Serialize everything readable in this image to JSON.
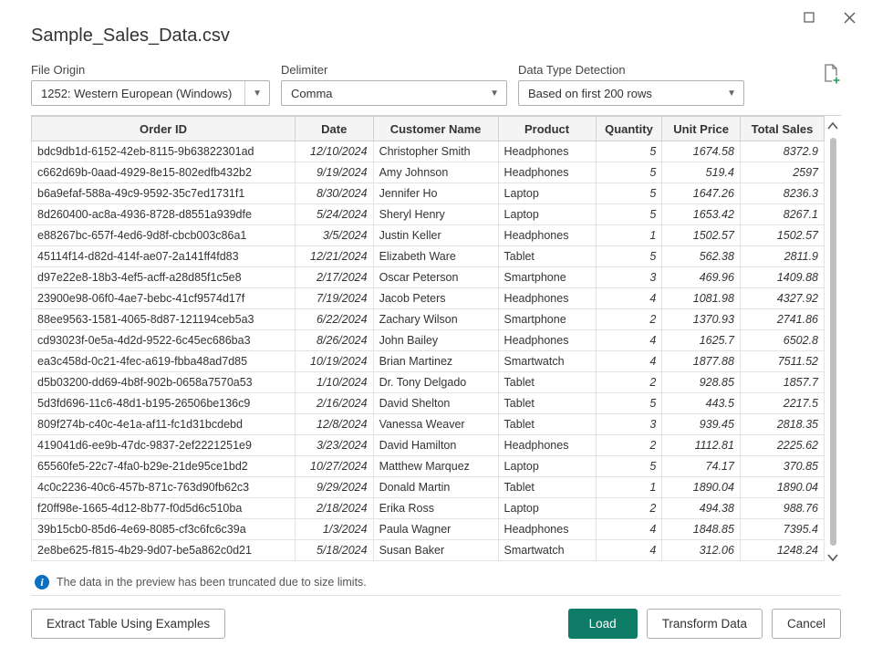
{
  "title": "Sample_Sales_Data.csv",
  "controls": {
    "file_origin": {
      "label": "File Origin",
      "value": "1252: Western European (Windows)"
    },
    "delimiter": {
      "label": "Delimiter",
      "value": "Comma"
    },
    "data_type_detection": {
      "label": "Data Type Detection",
      "value": "Based on first 200 rows"
    }
  },
  "columns": [
    "Order ID",
    "Date",
    "Customer Name",
    "Product",
    "Quantity",
    "Unit Price",
    "Total Sales"
  ],
  "rows": [
    {
      "order_id": "bdc9db1d-6152-42eb-8115-9b63822301ad",
      "date": "12/10/2024",
      "customer": "Christopher Smith",
      "product": "Headphones",
      "qty": "5",
      "price": "1674.58",
      "total": "8372.9"
    },
    {
      "order_id": "c662d69b-0aad-4929-8e15-802edfb432b2",
      "date": "9/19/2024",
      "customer": "Amy Johnson",
      "product": "Headphones",
      "qty": "5",
      "price": "519.4",
      "total": "2597"
    },
    {
      "order_id": "b6a9efaf-588a-49c9-9592-35c7ed1731f1",
      "date": "8/30/2024",
      "customer": "Jennifer Ho",
      "product": "Laptop",
      "qty": "5",
      "price": "1647.26",
      "total": "8236.3"
    },
    {
      "order_id": "8d260400-ac8a-4936-8728-d8551a939dfe",
      "date": "5/24/2024",
      "customer": "Sheryl Henry",
      "product": "Laptop",
      "qty": "5",
      "price": "1653.42",
      "total": "8267.1"
    },
    {
      "order_id": "e88267bc-657f-4ed6-9d8f-cbcb003c86a1",
      "date": "3/5/2024",
      "customer": "Justin Keller",
      "product": "Headphones",
      "qty": "1",
      "price": "1502.57",
      "total": "1502.57"
    },
    {
      "order_id": "45114f14-d82d-414f-ae07-2a141ff4fd83",
      "date": "12/21/2024",
      "customer": "Elizabeth Ware",
      "product": "Tablet",
      "qty": "5",
      "price": "562.38",
      "total": "2811.9"
    },
    {
      "order_id": "d97e22e8-18b3-4ef5-acff-a28d85f1c5e8",
      "date": "2/17/2024",
      "customer": "Oscar Peterson",
      "product": "Smartphone",
      "qty": "3",
      "price": "469.96",
      "total": "1409.88"
    },
    {
      "order_id": "23900e98-06f0-4ae7-bebc-41cf9574d17f",
      "date": "7/19/2024",
      "customer": "Jacob Peters",
      "product": "Headphones",
      "qty": "4",
      "price": "1081.98",
      "total": "4327.92"
    },
    {
      "order_id": "88ee9563-1581-4065-8d87-121194ceb5a3",
      "date": "6/22/2024",
      "customer": "Zachary Wilson",
      "product": "Smartphone",
      "qty": "2",
      "price": "1370.93",
      "total": "2741.86"
    },
    {
      "order_id": "cd93023f-0e5a-4d2d-9522-6c45ec686ba3",
      "date": "8/26/2024",
      "customer": "John Bailey",
      "product": "Headphones",
      "qty": "4",
      "price": "1625.7",
      "total": "6502.8"
    },
    {
      "order_id": "ea3c458d-0c21-4fec-a619-fbba48ad7d85",
      "date": "10/19/2024",
      "customer": "Brian Martinez",
      "product": "Smartwatch",
      "qty": "4",
      "price": "1877.88",
      "total": "7511.52"
    },
    {
      "order_id": "d5b03200-dd69-4b8f-902b-0658a7570a53",
      "date": "1/10/2024",
      "customer": "Dr. Tony Delgado",
      "product": "Tablet",
      "qty": "2",
      "price": "928.85",
      "total": "1857.7"
    },
    {
      "order_id": "5d3fd696-11c6-48d1-b195-26506be136c9",
      "date": "2/16/2024",
      "customer": "David Shelton",
      "product": "Tablet",
      "qty": "5",
      "price": "443.5",
      "total": "2217.5"
    },
    {
      "order_id": "809f274b-c40c-4e1a-af11-fc1d31bcdebd",
      "date": "12/8/2024",
      "customer": "Vanessa Weaver",
      "product": "Tablet",
      "qty": "3",
      "price": "939.45",
      "total": "2818.35"
    },
    {
      "order_id": "419041d6-ee9b-47dc-9837-2ef2221251e9",
      "date": "3/23/2024",
      "customer": "David Hamilton",
      "product": "Headphones",
      "qty": "2",
      "price": "1112.81",
      "total": "2225.62"
    },
    {
      "order_id": "65560fe5-22c7-4fa0-b29e-21de95ce1bd2",
      "date": "10/27/2024",
      "customer": "Matthew Marquez",
      "product": "Laptop",
      "qty": "5",
      "price": "74.17",
      "total": "370.85"
    },
    {
      "order_id": "4c0c2236-40c6-457b-871c-763d90fb62c3",
      "date": "9/29/2024",
      "customer": "Donald Martin",
      "product": "Tablet",
      "qty": "1",
      "price": "1890.04",
      "total": "1890.04"
    },
    {
      "order_id": "f20ff98e-1665-4d12-8b77-f0d5d6c510ba",
      "date": "2/18/2024",
      "customer": "Erika Ross",
      "product": "Laptop",
      "qty": "2",
      "price": "494.38",
      "total": "988.76"
    },
    {
      "order_id": "39b15cb0-85d6-4e69-8085-cf3c6fc6c39a",
      "date": "1/3/2024",
      "customer": "Paula Wagner",
      "product": "Headphones",
      "qty": "4",
      "price": "1848.85",
      "total": "7395.4"
    },
    {
      "order_id": "2e8be625-f815-4b29-9d07-be5a862c0d21",
      "date": "5/18/2024",
      "customer": "Susan Baker",
      "product": "Smartwatch",
      "qty": "4",
      "price": "312.06",
      "total": "1248.24"
    }
  ],
  "info_message": "The data in the preview has been truncated due to size limits.",
  "footer": {
    "extract": "Extract Table Using Examples",
    "load": "Load",
    "transform": "Transform Data",
    "cancel": "Cancel"
  }
}
